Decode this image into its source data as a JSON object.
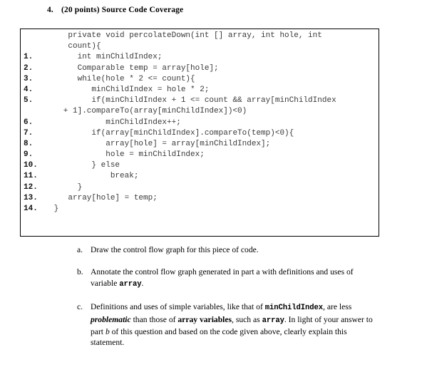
{
  "heading": {
    "number": "4.",
    "points": "(20 points)",
    "title": "Source Code Coverage"
  },
  "code": {
    "lines": [
      {
        "num": "",
        "text": "    private void percolateDown(int [] array, int hole, int"
      },
      {
        "num": "",
        "text": "    count){"
      },
      {
        "num": "1.",
        "text": "      int minChildIndex;"
      },
      {
        "num": "2.",
        "text": "      Comparable temp = array[hole];"
      },
      {
        "num": "3.",
        "text": "      while(hole * 2 <= count){"
      },
      {
        "num": "4.",
        "text": "         minChildIndex = hole * 2;"
      },
      {
        "num": "5.",
        "text": "         if(minChildIndex + 1 <= count && array[minChildIndex"
      },
      {
        "num": "",
        "text": "   + 1].compareTo(array[minChildIndex])<0)"
      },
      {
        "num": "6.",
        "text": "            minChildIndex++;"
      },
      {
        "num": "7.",
        "text": "         if(array[minChildIndex].compareTo(temp)<0){"
      },
      {
        "num": "8.",
        "text": "            array[hole] = array[minChildIndex];"
      },
      {
        "num": "9.",
        "text": "            hole = minChildIndex;"
      },
      {
        "num": "10.",
        "text": "         } else"
      },
      {
        "num": "11.",
        "text": "             break;"
      },
      {
        "num": "12.",
        "text": "      }"
      },
      {
        "num": "13.",
        "text": "    array[hole] = temp;"
      },
      {
        "num": "14.",
        "text": " }"
      }
    ]
  },
  "subitems": {
    "a": {
      "marker": "a.",
      "text": "Draw the control flow graph for this piece of code."
    },
    "b": {
      "marker": "b.",
      "text_1": "Annotate the control flow graph generated in part a with definitions and uses of variable ",
      "mono_1": "array",
      "text_2": "."
    },
    "c": {
      "marker": "c.",
      "text_1": "Definitions and uses of simple variables, like that of ",
      "mono_1": "minChildIndex",
      "text_2": ", are less ",
      "emph_1": "problematic",
      "text_3": " than those of ",
      "bold_1": "array variables",
      "text_4": ", such as ",
      "mono_2": "array",
      "text_5": ".  In light of your answer to part ",
      "italic_1": "b",
      "text_6": " of this question and based on the code given above, clearly explain this statement."
    }
  }
}
